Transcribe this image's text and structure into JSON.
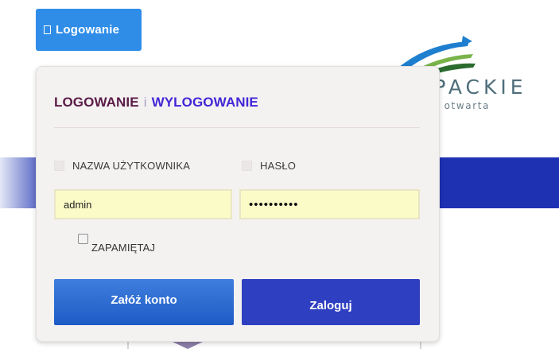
{
  "header": {
    "login_button_label": "Logowanie"
  },
  "logo": {
    "text": "RPACKIE",
    "subtitle": "ń otwarta"
  },
  "dialog": {
    "title_login": "LOGOWANIE",
    "title_separator": "i",
    "title_logout": "WYLOGOWANIE",
    "username_label": "NAZWA UŻYTKOWNIKA",
    "password_label": "HASŁO",
    "username_value": "admin",
    "password_value": "••••••••••",
    "remember_label": "ZAPAMIĘTAJ",
    "register_button": "Załóż konto",
    "login_button": "Zaloguj"
  },
  "colors": {
    "primary_blue": "#2f8de8",
    "dark_blue": "#2f3fc1",
    "title_logout": "#4127d6",
    "title_login": "#5a1c47",
    "input_bg": "#fbfbc7"
  }
}
